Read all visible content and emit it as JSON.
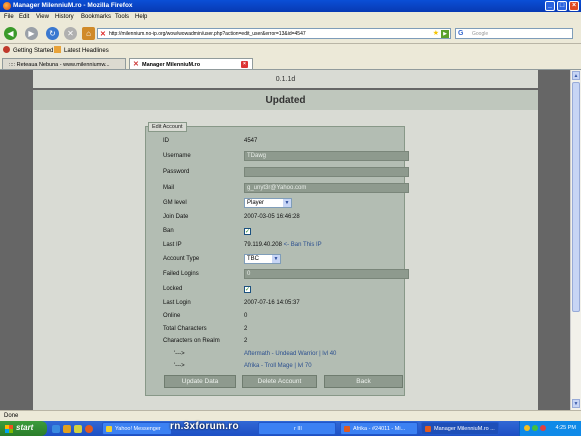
{
  "window": {
    "title": "Manager MilenniuM.ro - Mozilla Firefox",
    "controls": [
      "_",
      "□",
      "×"
    ]
  },
  "menu": [
    "File",
    "Edit",
    "View",
    "History",
    "Bookmarks",
    "Tools",
    "Help"
  ],
  "nav": {
    "url": "http://milennium.no-ip.org/wow/wowadmin/user.php?action=edit_user&error=13&id=4547",
    "search_placeholder": "Google"
  },
  "bookmarks": [
    "Getting Started",
    "Latest Headlines"
  ],
  "tabs": [
    {
      "label": ":::: Reteaua Nebuna - www.milenniumw...",
      "active": false
    },
    {
      "label": "Manager MilenniuM.ro",
      "active": true
    }
  ],
  "page": {
    "version": "0.1.1d",
    "heading": "Updated",
    "legend": "Edit Account",
    "labels": {
      "id": "ID",
      "username": "Username",
      "password": "Password",
      "mail": "Mail",
      "gm_level": "GM level",
      "join_date": "Join Date",
      "ban": "Ban",
      "last_ip": "Last IP",
      "account_type": "Account Type",
      "failed_logins": "Failed Logins",
      "locked": "Locked",
      "last_login": "Last Login",
      "online": "Online",
      "total_characters": "Total Characters",
      "characters_on_realm": "Characters on Realm"
    },
    "values": {
      "id": "4547",
      "username": "TDawg",
      "password": "",
      "mail": "g_unyt3r@Yahoo.com",
      "gm_level": "Player",
      "join_date": "2007-03-05 16:46:28",
      "last_ip": "79.119.40.208",
      "ban_ip_link": "<- Ban This IP",
      "account_type": "TBC",
      "failed_logins": "0",
      "last_login": "2007-07-16 14:05:37",
      "online": "0",
      "total_characters": "2",
      "characters_on_realm": "2"
    },
    "ban_checked": true,
    "locked_checked": true,
    "characters": [
      {
        "arrow": "'--->",
        "link": "Aftermath - Undead Warrior | lvl 40"
      },
      {
        "arrow": "'--->",
        "link": "Afrika - Troll Mage | lvl 70"
      }
    ],
    "buttons": {
      "update": "Update Data",
      "delete": "Delete Account",
      "back": "Back"
    }
  },
  "status": "Done",
  "taskbar": {
    "start": "start",
    "tasks": [
      {
        "label": "Yahoo! Messenger",
        "active": false
      },
      {
        "label": "r III",
        "active": false
      },
      {
        "label": "Afrika - #24011 - Mi...",
        "active": false
      },
      {
        "label": "Manager MilenniuM.ro ...",
        "active": true
      }
    ],
    "watermark": "rn.3xforum.ro",
    "clock": "4:25 PM"
  },
  "colors": {
    "titlebar": "#0a4fd6",
    "page_background": "#666666",
    "panel": "#d9dbd4",
    "fieldset": "#b3bdb3",
    "field": "#8e9a8e",
    "link": "#2b4f8f"
  }
}
